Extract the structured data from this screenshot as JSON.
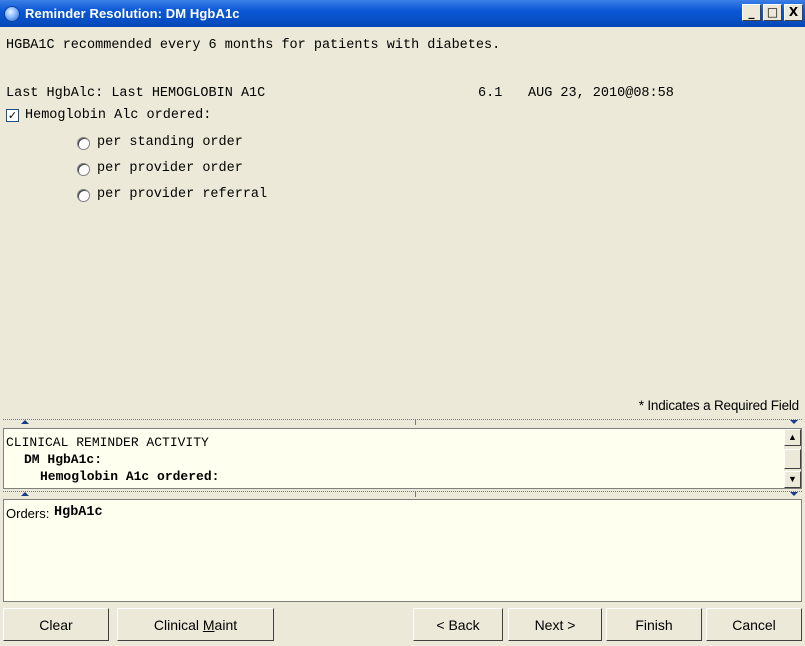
{
  "window": {
    "title": "Reminder Resolution: DM HgbA1c",
    "minimize": "_",
    "maximize": "□",
    "close": "X"
  },
  "content": {
    "recommendation": "HGBA1C recommended every 6 months for patients with diabetes.",
    "last_label": "Last HgbAlc: Last HEMOGLOBIN A1C",
    "last_value": "6.1",
    "last_date": "AUG 23, 2010@08:58",
    "checkbox_label": "Hemoglobin Alc ordered:",
    "checkbox_checked": true,
    "radio_options": [
      "per standing order",
      "per provider order",
      "per provider referral"
    ],
    "required_note": "* Indicates a Required Field"
  },
  "activity": {
    "lines": [
      "CLINICAL REMINDER ACTIVITY",
      "DM HgbA1c:",
      "Hemoglobin A1c ordered:"
    ]
  },
  "orders": {
    "label": "Orders:",
    "value": "HgbA1c"
  },
  "buttons": {
    "clear": "Clear",
    "clinical_maint_pre": "Clinical ",
    "clinical_maint_accel": "M",
    "clinical_maint_post": "aint",
    "back": "< Back",
    "next": "Next >",
    "finish": "Finish",
    "cancel": "Cancel"
  }
}
